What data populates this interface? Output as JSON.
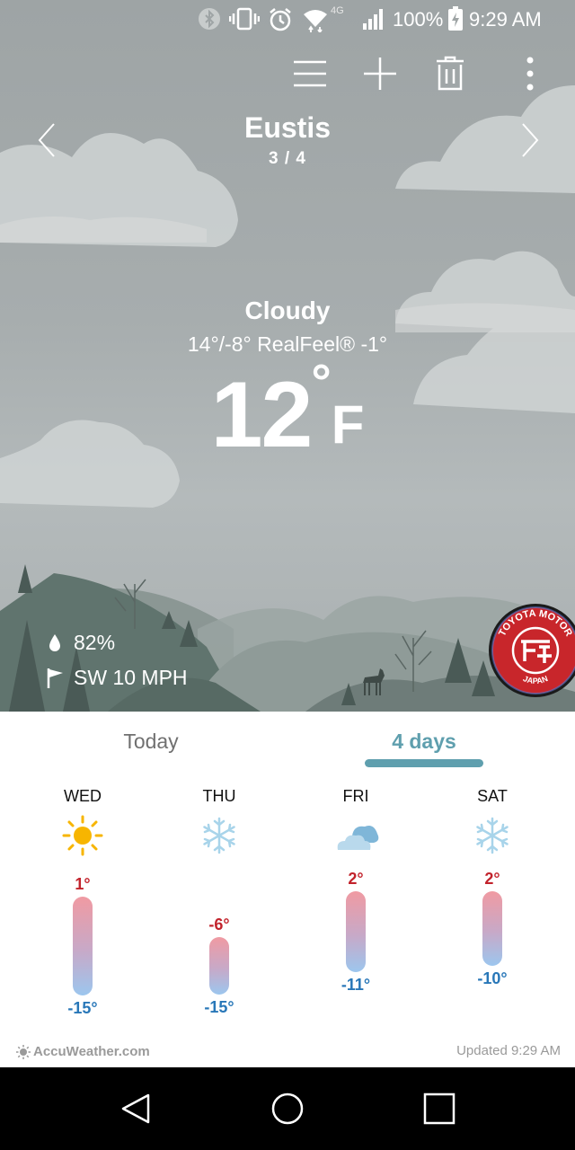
{
  "status_bar": {
    "battery_percent": "100%",
    "time": "9:29 AM",
    "network": "4G",
    "icons": [
      "bluetooth-icon",
      "vibrate-icon",
      "alarm-icon",
      "wifi-icon",
      "signal-icon",
      "battery-charging-icon"
    ]
  },
  "toolbar": {
    "icons": [
      "menu-icon",
      "add-icon",
      "delete-icon",
      "more-icon"
    ]
  },
  "location": {
    "name": "Eustis",
    "index": "3 / 4"
  },
  "current": {
    "condition": "Cloudy",
    "hilo_realfeel": "14°/-8° RealFeel® -1°",
    "temperature": "12",
    "degree": "°",
    "unit": "F",
    "humidity": "82%",
    "wind": "SW 10 MPH"
  },
  "badge": {
    "top_text": "TOYOTA MOTOR",
    "bottom_text": "JAPAN"
  },
  "tabs": [
    {
      "label": "Today",
      "selected": false
    },
    {
      "label": "4 days",
      "selected": true
    }
  ],
  "forecast": [
    {
      "day": "WED",
      "icon": "sun-icon",
      "high": "1°",
      "low": "-15°",
      "high_value": 1,
      "low_value": -15
    },
    {
      "day": "THU",
      "icon": "snowflake-icon",
      "high": "-6°",
      "low": "-15°",
      "high_value": -6,
      "low_value": -15
    },
    {
      "day": "FRI",
      "icon": "cloudy-icon",
      "high": "2°",
      "low": "-11°",
      "high_value": 2,
      "low_value": -11
    },
    {
      "day": "SAT",
      "icon": "snowflake-icon",
      "high": "2°",
      "low": "-10°",
      "high_value": 2,
      "low_value": -10
    }
  ],
  "footer": {
    "brand": "AccuWeather.com",
    "updated": "Updated 9:29 AM"
  },
  "colors": {
    "accent": "#5f9fae",
    "high_temp": "#c2232c",
    "low_temp": "#2877b8"
  }
}
